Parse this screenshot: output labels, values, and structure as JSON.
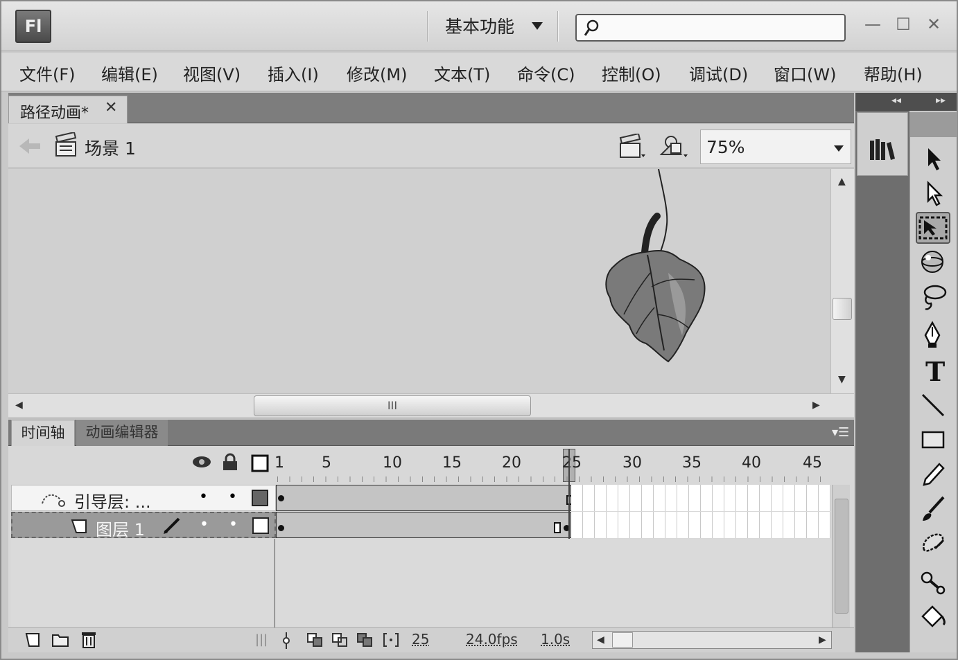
{
  "app": {
    "logo": "Fl",
    "workspace": "基本功能"
  },
  "window_controls": {
    "minimize": "—",
    "maximize": "☐",
    "close": "✕"
  },
  "menu": [
    "文件(F)",
    "编辑(E)",
    "视图(V)",
    "插入(I)",
    "修改(M)",
    "文本(T)",
    "命令(C)",
    "控制(O)",
    "调试(D)",
    "窗口(W)",
    "帮助(H)"
  ],
  "document": {
    "tab_title": "路径动画*",
    "tab_close": "✕"
  },
  "editbar": {
    "scene": "场景 1",
    "zoom": "75%"
  },
  "stage": {
    "scroll_label": "III"
  },
  "timeline": {
    "tabs": [
      "时间轴",
      "动画编辑器"
    ],
    "frame_numbers": [
      "1",
      "5",
      "10",
      "15",
      "20",
      "25",
      "30",
      "35",
      "40",
      "45"
    ],
    "layers": [
      {
        "name": "引导层: ...",
        "dot1": "•",
        "dot2": "•"
      },
      {
        "name": "图层 1",
        "dot1": "•",
        "dot2": "•"
      }
    ],
    "status": {
      "frame": "25",
      "fps": "24.0fps",
      "time": "1.0s"
    }
  },
  "icons": {
    "search": "search-icon",
    "back": "back-arrow-icon",
    "scene": "clapperboard-icon",
    "library": "library-icon",
    "tools": [
      "selection-tool-icon",
      "subselection-tool-icon",
      "free-transform-tool-icon",
      "3d-rotation-tool-icon",
      "lasso-tool-icon",
      "pen-tool-icon",
      "text-tool-icon",
      "line-tool-icon",
      "rectangle-tool-icon",
      "pencil-tool-icon",
      "brush-tool-icon",
      "deco-tool-icon",
      "bone-tool-icon",
      "paint-bucket-tool-icon"
    ]
  }
}
